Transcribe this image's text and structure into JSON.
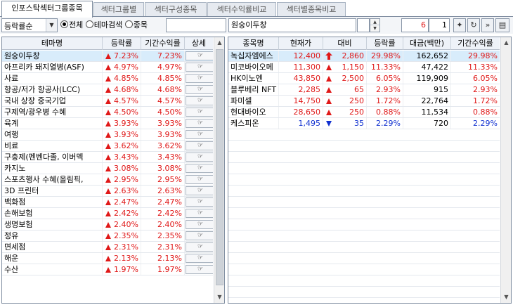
{
  "tabs": [
    {
      "label": "인포스탁섹터그룹종목",
      "active": true
    },
    {
      "label": "섹터그룹별",
      "active": false
    },
    {
      "label": "섹터구성종목",
      "active": false
    },
    {
      "label": "섹터수익률비교",
      "active": false
    },
    {
      "label": "섹터별종목비교",
      "active": false
    }
  ],
  "toolbar": {
    "sort_select": "등락률순",
    "radio_all": "전체",
    "radio_theme": "테마검색",
    "radio_stock": "종목",
    "search_value": "",
    "selected_theme": "원숭이두창",
    "page_current": "6",
    "page_step": "1"
  },
  "left_table": {
    "headers": [
      "테마명",
      "등락률",
      "기간수익률",
      "상세"
    ],
    "rows": [
      {
        "name": "원숭이두창",
        "change": "7.23%",
        "period": "7.23%"
      },
      {
        "name": "아프리카 돼지열병(ASF)",
        "change": "4.97%",
        "period": "4.97%"
      },
      {
        "name": "사료",
        "change": "4.85%",
        "period": "4.85%"
      },
      {
        "name": "항공/저가 항공사(LCC)",
        "change": "4.68%",
        "period": "4.68%"
      },
      {
        "name": "국내 상장 중국기업",
        "change": "4.57%",
        "period": "4.57%"
      },
      {
        "name": "구제역/광우병 수혜",
        "change": "4.50%",
        "period": "4.50%"
      },
      {
        "name": "육계",
        "change": "3.93%",
        "period": "3.93%"
      },
      {
        "name": "여행",
        "change": "3.93%",
        "period": "3.93%"
      },
      {
        "name": "비료",
        "change": "3.62%",
        "period": "3.62%"
      },
      {
        "name": "구충제(펜벤다졸, 이버멕",
        "change": "3.43%",
        "period": "3.43%"
      },
      {
        "name": "카지노",
        "change": "3.08%",
        "period": "3.08%"
      },
      {
        "name": "스포츠행사 수혜(올림픽,",
        "change": "2.95%",
        "period": "2.95%"
      },
      {
        "name": "3D 프린터",
        "change": "2.63%",
        "period": "2.63%"
      },
      {
        "name": "백화점",
        "change": "2.47%",
        "period": "2.47%"
      },
      {
        "name": "손해보험",
        "change": "2.42%",
        "period": "2.42%"
      },
      {
        "name": "생명보험",
        "change": "2.40%",
        "period": "2.40%"
      },
      {
        "name": "정유",
        "change": "2.35%",
        "period": "2.35%"
      },
      {
        "name": "면세점",
        "change": "2.31%",
        "period": "2.31%"
      },
      {
        "name": "해운",
        "change": "2.13%",
        "period": "2.13%"
      },
      {
        "name": "수산",
        "change": "1.97%",
        "period": "1.97%"
      }
    ]
  },
  "right_table": {
    "headers": [
      "종목명",
      "현재가",
      "대비",
      "등락률",
      "대금(백만)",
      "기간수익률"
    ],
    "rows": [
      {
        "name": "녹십자엠에스",
        "price": "12,400",
        "dir": "upper",
        "diff": "2,860",
        "rate": "29.98%",
        "amount": "162,652",
        "period": "29.98%"
      },
      {
        "name": "미코바이오메",
        "price": "11,300",
        "dir": "up",
        "diff": "1,150",
        "rate": "11.33%",
        "amount": "47,422",
        "period": "11.33%"
      },
      {
        "name": "HK이노엔",
        "price": "43,850",
        "dir": "up",
        "diff": "2,500",
        "rate": "6.05%",
        "amount": "119,909",
        "period": "6.05%"
      },
      {
        "name": "블루베리 NFT",
        "price": "2,285",
        "dir": "up",
        "diff": "65",
        "rate": "2.93%",
        "amount": "915",
        "period": "2.93%"
      },
      {
        "name": "파미셀",
        "price": "14,750",
        "dir": "up",
        "diff": "250",
        "rate": "1.72%",
        "amount": "22,764",
        "period": "1.72%"
      },
      {
        "name": "현대바이오",
        "price": "28,650",
        "dir": "up",
        "diff": "250",
        "rate": "0.88%",
        "amount": "11,534",
        "period": "0.88%"
      },
      {
        "name": "케스피온",
        "price": "1,495",
        "dir": "down",
        "diff": "35",
        "rate": "2.29%",
        "amount": "720",
        "period": "2.29%"
      }
    ]
  },
  "colors": {
    "up": "#e01818",
    "down": "#1030d0",
    "selected_row": "#d8ecfb",
    "header_bg": "#eef2f8"
  }
}
